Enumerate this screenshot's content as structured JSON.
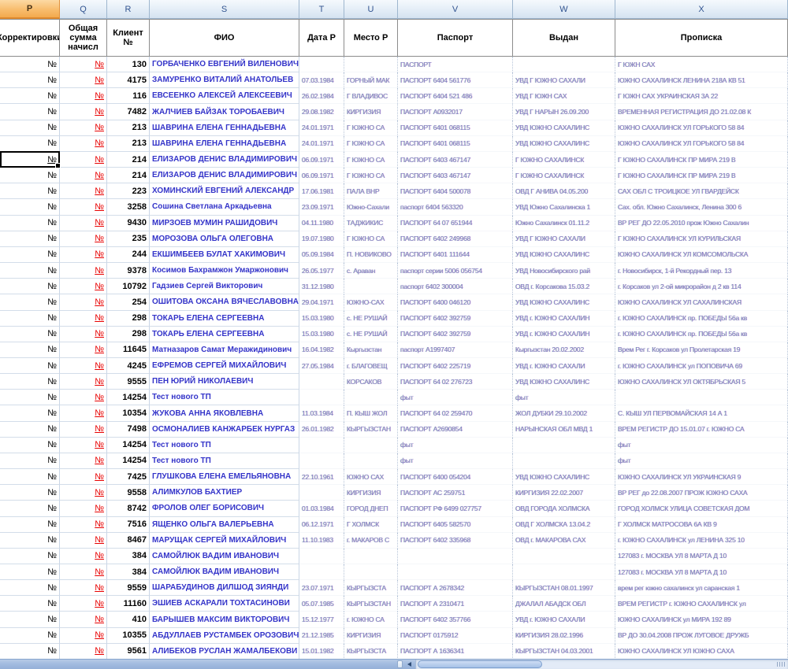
{
  "sheet": {
    "column_letters": [
      "P",
      "Q",
      "R",
      "S",
      "T",
      "U",
      "V",
      "W",
      "X"
    ],
    "selected_column": "P",
    "headers": {
      "corr": "Корректировки",
      "total": "Общая сумма начисл",
      "client": "Клиент №",
      "fio": "ФИО",
      "birth": "Дата Р",
      "place": "Место Р",
      "passport": "Паспорт",
      "issued": "Выдан",
      "address": "Прописка"
    },
    "active_cell": {
      "column": "P",
      "row_index": 6
    },
    "rows": [
      {
        "corr": "№",
        "total": "№",
        "client": "130",
        "fio": "ГОРБАЧЕНКО ЕВГЕНИЙ ВИЛЕНОВИЧ",
        "birth": "",
        "place": "",
        "passport": "ПАСПОРТ",
        "issued": "",
        "address": "Г ЮЖН САХ"
      },
      {
        "corr": "№",
        "total": "№",
        "client": "4175",
        "fio": "ЗАМУРЕНКО ВИТАЛИЙ АНАТОЛЬЕВ",
        "birth": "07.03.1984",
        "place": "ГОРНЫЙ МАК",
        "passport": "ПАСПОРТ 6404 561776",
        "issued": "УВД Г ЮЖНО САХАЛИ",
        "address": "ЮЖНО САХАЛИНСК ЛЕНИНА 218А КВ 51"
      },
      {
        "corr": "№",
        "total": "№",
        "client": "116",
        "fio": "ЕВСЕЕНКО АЛЕКСЕЙ АЛЕКСЕЕВИЧ",
        "birth": "26.02.1984",
        "place": "Г ВЛАДИВОС",
        "passport": "ПАСПОРТ 6404 521 486",
        "issued": "УВД Г ЮЖН САХ",
        "address": "Г ЮЖН САХ УКРАИНСКАЯ 3А 22"
      },
      {
        "corr": "№",
        "total": "№",
        "client": "7482",
        "fio": "ЖАЛЧИЕВ БАЙЗАК ТОРОБАЕВИЧ",
        "birth": "29.08.1982",
        "place": "КИРГИЗИЯ",
        "passport": "ПАСПОРТ А0932017",
        "issued": "УВД Г НАРЫН 26.09.200",
        "address": "ВРЕМЕННАЯ РЕГИСТРАЦИЯ ДО 21.02.08 К"
      },
      {
        "corr": "№",
        "total": "№",
        "client": "213",
        "fio": "ШАВРИНА ЕЛЕНА ГЕННАДЬЕВНА",
        "birth": "24.01.1971",
        "place": "Г ЮЖНО СА",
        "passport": "ПАСПОРТ 6401 068115",
        "issued": "УВД ЮЖНО САХАЛИНС",
        "address": "ЮЖНО САХАЛИНСК УЛ ГОРЬКОГО 58 84"
      },
      {
        "corr": "№",
        "total": "№",
        "client": "213",
        "fio": "ШАВРИНА ЕЛЕНА ГЕННАДЬЕВНА",
        "birth": "24.01.1971",
        "place": "Г ЮЖНО СА",
        "passport": "ПАСПОРТ 6401 068115",
        "issued": "УВД ЮЖНО САХАЛИНС",
        "address": "ЮЖНО САХАЛИНСК УЛ ГОРЬКОГО 58 84"
      },
      {
        "corr": "№",
        "total": "№",
        "client": "214",
        "fio": "ЕЛИЗАРОВ ДЕНИС ВЛАДИМИРОВИЧ",
        "birth": "06.09.1971",
        "place": "Г ЮЖНО СА",
        "passport": "ПАСПОРТ 6403 467147",
        "issued": "Г ЮЖНО САХАЛИНСК",
        "address": "Г ЮЖНО САХАЛИНСК ПР МИРА 219 В"
      },
      {
        "corr": "№",
        "total": "№",
        "client": "214",
        "fio": "ЕЛИЗАРОВ ДЕНИС ВЛАДИМИРОВИЧ",
        "birth": "06.09.1971",
        "place": "Г ЮЖНО СА",
        "passport": "ПАСПОРТ 6403 467147",
        "issued": "Г ЮЖНО САХАЛИНСК",
        "address": "Г ЮЖНО САХАЛИНСК ПР МИРА 219 В"
      },
      {
        "corr": "№",
        "total": "№",
        "client": "223",
        "fio": "ХОМИНСКИЙ ЕВГЕНИЙ АЛЕКСАНДР",
        "birth": "17.06.1981",
        "place": "ПАЛА ВНР",
        "passport": "ПАСПОРТ 6404 500078",
        "issued": "ОВД Г АНИВА 04.05.200",
        "address": "САХ ОБЛ С ТРОИЦКОЕ УЛ ГВАРДЕЙСК"
      },
      {
        "corr": "№",
        "total": "№",
        "client": "3258",
        "fio": "Сошина Светлана Аркадьевна",
        "birth": "23.09.1971",
        "place": "Южно-Сахали",
        "passport": "паспорт 6404 563320",
        "issued": "УВД Южно Сахалинска 1",
        "address": "Сах. обл. Южно Сахалинск, Ленина 300 6"
      },
      {
        "corr": "№",
        "total": "№",
        "client": "9430",
        "fio": "МИРЗОЕВ МУМИН РАШИДОВИЧ",
        "birth": "04.11.1980",
        "place": "ТАДЖИКИС",
        "passport": "ПАСПОРТ 64 07 651944",
        "issued": "Южно Сахалинск 01.11.2",
        "address": "ВР РЕГ ДО 22.05.2010 прож Южно Сахалин"
      },
      {
        "corr": "№",
        "total": "№",
        "client": "235",
        "fio": "МОРОЗОВА ОЛЬГА ОЛЕГОВНА",
        "birth": "19.07.1980",
        "place": "Г ЮЖНО СА",
        "passport": "ПАСПОРТ 6402 249968",
        "issued": "УВД Г ЮЖНО САХАЛИ",
        "address": "Г ЮЖНО САХАЛИНСК УЛ КУРИЛЬСКАЯ"
      },
      {
        "corr": "№",
        "total": "№",
        "client": "244",
        "fio": "ЕКШИМБЕЕВ БУЛАТ ХАКИМОВИЧ",
        "birth": "05.09.1984",
        "place": "П. НОВИКОВО",
        "passport": "ПАСПОРТ 6401 111644",
        "issued": "УВД ЮЖНО САХАЛИНС",
        "address": "ЮЖНО САХАЛИНСК УЛ КОМСОМОЛЬСКА"
      },
      {
        "corr": "№",
        "total": "№",
        "client": "9378",
        "fio": "Косимов Бахрамжон Умаржонович",
        "birth": "26.05.1977",
        "place": "с. Араван",
        "passport": "паспорт серии 5006 056754",
        "issued": "УВД Новосибирского рай",
        "address": "г. Новосибирск, 1-й Рекордный пер. 13"
      },
      {
        "corr": "№",
        "total": "№",
        "client": "10792",
        "fio": "Гадзиев Сергей Викторович",
        "birth": "31.12.1980",
        "place": "",
        "passport": "паспорт 6402 300004",
        "issued": "ОВД г. Корсакова 15.03.2",
        "address": "г. Корсаков ул 2-ой микрорайон д 2 кв 114"
      },
      {
        "corr": "№",
        "total": "№",
        "client": "254",
        "fio": "ОШИТОВА ОКСАНА ВЯЧЕСЛАВОВНА",
        "birth": "29.04.1971",
        "place": "ЮЖНО-САХ",
        "passport": "ПАСПОРТ 6400 046120",
        "issued": "УВД ЮЖНО САХАЛИНС",
        "address": "ЮЖНО САХАЛИНСК УЛ САХАЛИНСКАЯ"
      },
      {
        "corr": "№",
        "total": "№",
        "client": "298",
        "fio": "ТОКАРЬ ЕЛЕНА СЕРГЕЕВНА",
        "birth": "15.03.1980",
        "place": "с. НЕ РУШАЙ",
        "passport": "ПАСПОРТ 6402 392759",
        "issued": "УВД г. ЮЖНО САХАЛИН",
        "address": "г. ЮЖНО САХАЛИНСК пр. ПОБЕДЫ 56а кв"
      },
      {
        "corr": "№",
        "total": "№",
        "client": "298",
        "fio": "ТОКАРЬ ЕЛЕНА СЕРГЕЕВНА",
        "birth": "15.03.1980",
        "place": "с. НЕ РУШАЙ",
        "passport": "ПАСПОРТ 6402 392759",
        "issued": "УВД г. ЮЖНО САХАЛИН",
        "address": "г. ЮЖНО САХАЛИНСК пр. ПОБЕДЫ 56а кв"
      },
      {
        "corr": "№",
        "total": "№",
        "client": "11645",
        "fio": "Матназаров Самат Меражидинович",
        "birth": "16.04.1982",
        "place": "Кыргызстан",
        "passport": "паспорт А1997407",
        "issued": "Кыргызстан 20.02.2002",
        "address": "Врем Рег г. Корсаков ул Пролетарская 19"
      },
      {
        "corr": "№",
        "total": "№",
        "client": "4245",
        "fio": "ЕФРЕМОВ СЕРГЕЙ МИХАЙЛОВИЧ",
        "birth": "27.05.1984",
        "place": "г. БЛАГОВЕЩ",
        "passport": "ПАСПОРТ 6402 225719",
        "issued": "УВД г. ЮЖНО САХАЛИ",
        "address": "г. ЮЖНО САХАЛИНСК ул ПОПОВИЧА 69"
      },
      {
        "corr": "№",
        "total": "№",
        "client": "9555",
        "fio": "ПЕН ЮРИЙ НИКОЛАЕВИЧ",
        "birth": "",
        "place": "КОРСАКОВ",
        "passport": "ПАСПОРТ 64 02 276723",
        "issued": "УВД ЮЖНО САХАЛИНС",
        "address": "ЮЖНО САХАЛИНСК УЛ ОКТЯБРЬСКАЯ 5"
      },
      {
        "corr": "№",
        "total": "№",
        "client": "14254",
        "fio": "Тест нового ТП",
        "birth": "",
        "place": "",
        "passport": "фыт",
        "issued": "фыт",
        "address": ""
      },
      {
        "corr": "№",
        "total": "№",
        "client": "10354",
        "fio": "ЖУКОВА АННА ЯКОВЛЕВНА",
        "birth": "11.03.1984",
        "place": "П. КЫШ ЖОЛ",
        "passport": "ПАСПОРТ 64 02 259470",
        "issued": "ЖОЛ ДУБКИ 29.10.2002",
        "address": "С. КЫШ УЛ ПЕРВОМАЙСКАЯ 14 А 1"
      },
      {
        "corr": "№",
        "total": "№",
        "client": "7498",
        "fio": "ОСМОНАЛИЕВ КАНЖАРБЕК НУРГАЗ",
        "birth": "26.01.1982",
        "place": "КЫРГЫЗСТАН",
        "passport": "ПАСПОРТ А2690854",
        "issued": "НАРЫНСКАЯ ОБЛ МВД 1",
        "address": "ВРЕМ РЕГИСТР ДО 15.01.07 г. ЮЖНО СА"
      },
      {
        "corr": "№",
        "total": "№",
        "client": "14254",
        "fio": "Тест нового ТП",
        "birth": "",
        "place": "",
        "passport": "фыт",
        "issued": "",
        "address": "фыт"
      },
      {
        "corr": "№",
        "total": "№",
        "client": "14254",
        "fio": "Тест нового ТП",
        "birth": "",
        "place": "",
        "passport": "фыт",
        "issued": "",
        "address": "фыт"
      },
      {
        "corr": "№",
        "total": "№",
        "client": "7425",
        "fio": "ГЛУШКОВА ЕЛЕНА ЕМЕЛЬЯНОВНА",
        "birth": "22.10.1961",
        "place": "ЮЖНО САХ",
        "passport": "ПАСПОРТ 6400 054204",
        "issued": "УВД ЮЖНО САХАЛИНС",
        "address": "ЮЖНО САХАЛИНСК УЛ УКРАИНСКАЯ 9"
      },
      {
        "corr": "№",
        "total": "№",
        "client": "9558",
        "fio": "АЛИМКУЛОВ БАХТИЕР",
        "birth": "",
        "place": "КИРГИЗИЯ",
        "passport": "ПАСПОРТ АС 259751",
        "issued": "КИРГИЗИЯ 22.02.2007",
        "address": "ВР РЕГ до 22.08.2007 ПРОЖ ЮЖНО САХА"
      },
      {
        "corr": "№",
        "total": "№",
        "client": "8742",
        "fio": "ФРОЛОВ ОЛЕГ БОРИСОВИЧ",
        "birth": "01.03.1984",
        "place": "ГОРОД ДНЕП",
        "passport": "ПАСПОРТ РФ 6499 027757",
        "issued": "ОВД ГОРОДА ХОЛМСКА",
        "address": "ГОРОД ХОЛМСК УЛИЦА СОВЕТСКАЯ ДОМ"
      },
      {
        "corr": "№",
        "total": "№",
        "client": "7516",
        "fio": "ЯЩЕНКО ОЛЬГА ВАЛЕРЬЕВНА",
        "birth": "06.12.1971",
        "place": "Г ХОЛМСК",
        "passport": "ПАСПОРТ 6405 582570",
        "issued": "ОВД Г ХОЛМСКА 13.04.2",
        "address": "Г ХОЛМСК МАТРОСОВА 6А КВ 9"
      },
      {
        "corr": "№",
        "total": "№",
        "client": "8467",
        "fio": "МАРУЩАК СЕРГЕЙ МИХАЙЛОВИЧ",
        "birth": "11.10.1983",
        "place": "г. МАКАРОВ С",
        "passport": "ПАСПОРТ 6402 335968",
        "issued": "ОВД г. МАКАРОВА САХ",
        "address": "г. ЮЖНО САХАЛИНСК ул ЛЕНИНА 325 10"
      },
      {
        "corr": "№",
        "total": "№",
        "client": "384",
        "fio": "САМОЙЛЮК ВАДИМ ИВАНОВИЧ",
        "birth": "",
        "place": "",
        "passport": "",
        "issued": "",
        "address": "127083 г. МОСКВА УЛ 8 МАРТА Д 10"
      },
      {
        "corr": "№",
        "total": "№",
        "client": "384",
        "fio": "САМОЙЛЮК ВАДИМ ИВАНОВИЧ",
        "birth": "",
        "place": "",
        "passport": "",
        "issued": "",
        "address": "127083 г. МОСКВА УЛ 8 МАРТА Д 10"
      },
      {
        "corr": "№",
        "total": "№",
        "client": "9559",
        "fio": "ШАРАБУДИНОВ ДИЛШОД ЗИЯНДИ",
        "birth": "23.07.1971",
        "place": "КЫРГЫЗСТА",
        "passport": "ПАСПОРТ А 2678342",
        "issued": "КЫРГЫЗСТАН 08.01.1997",
        "address": "врем рег южно сахалинск ул саранская 1"
      },
      {
        "corr": "№",
        "total": "№",
        "client": "11160",
        "fio": "ЭШИЕВ АСКАРАЛИ ТОХТАСИНОВИ",
        "birth": "05.07.1985",
        "place": "КЫРГЫЗСТАН",
        "passport": "ПАСПОРТ А 2310471",
        "issued": "ДЖАЛАЛ АБАДСК ОБЛ",
        "address": "ВРЕМ РЕГИСТР г. ЮЖНО САХАЛИНСК ул"
      },
      {
        "corr": "№",
        "total": "№",
        "client": "410",
        "fio": "БАРЫШЕВ МАКСИМ ВИКТОРОВИЧ",
        "birth": "15.12.1977",
        "place": "г. ЮЖНО СА",
        "passport": "ПАСПОРТ 6402 357766",
        "issued": "УВД г. ЮЖНО САХАЛИ",
        "address": "ЮЖНО САХАЛИНСК ул МИРА 192 89"
      },
      {
        "corr": "№",
        "total": "№",
        "client": "10355",
        "fio": "АБДУЛЛАЕВ РУСТАМБЕК ОРОЗОВИЧ",
        "birth": "21.12.1985",
        "place": "КИРГИЗИЯ",
        "passport": "ПАСПОРТ 0175912",
        "issued": "КИРГИЗИЯ 28.02.1996",
        "address": "ВР ДО 30.04.2008 ПРОЖ ЛУГОВОЕ ДРУЖБ"
      },
      {
        "corr": "№",
        "total": "№",
        "client": "9561",
        "fio": "АЛИБЕКОВ РУСЛАН ЖАМАЛБЕКОВИ",
        "birth": "15.01.1982",
        "place": "КЫРГЫЗСТА",
        "passport": "ПАСПОРТ А 1636341",
        "issued": "КЫРГЫЗСТАН 04.03.2001",
        "address": "ЮЖНО САХАЛИНСК УЛ ЮЖНО САХА"
      }
    ],
    "colors": {
      "selected_header_orange": "#F2A649",
      "header_strip_blue": "#DCE6F1",
      "name_text_blue": "#3434C9",
      "red_number": "#E80000",
      "bottom_bar_blue": "#A3BCE0"
    }
  },
  "scrollbar": {
    "orientation": "horizontal",
    "left_arrow_icon": "scroll-left-icon",
    "tab_split_handle": "tab-split-handle"
  }
}
